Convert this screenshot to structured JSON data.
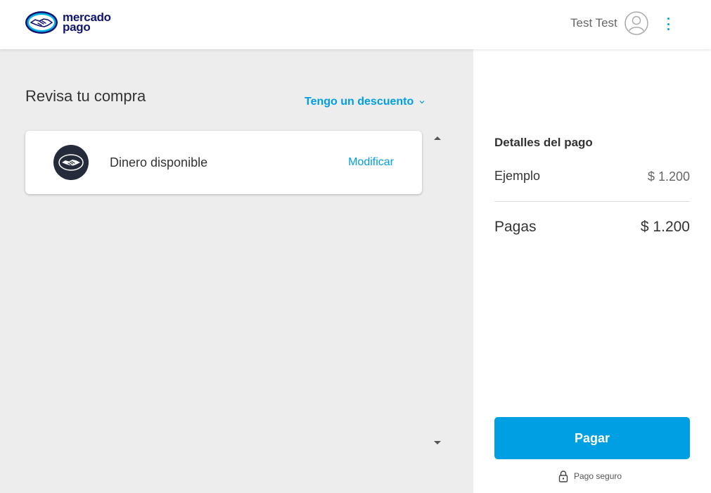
{
  "header": {
    "logo_line1": "mercado",
    "logo_line2": "pago",
    "user_name": "Test Test"
  },
  "main": {
    "title": "Revisa tu compra",
    "discount_label": "Tengo un descuento",
    "payment_method": {
      "label": "Dinero disponible",
      "action_label": "Modificar"
    }
  },
  "details": {
    "title": "Detalles del pago",
    "item_label": "Ejemplo",
    "item_value": "$ 1.200",
    "total_label": "Pagas",
    "total_value": "$ 1.200",
    "pay_button_label": "Pagar",
    "secure_label": "Pago seguro"
  },
  "colors": {
    "accent": "#009ee3",
    "brand_dark": "#10156f",
    "background": "#ededed"
  },
  "icons": {
    "logo": "handshake-icon",
    "avatar": "user-circle-icon",
    "menu": "kebab-menu-icon",
    "payment_method": "handshake-icon",
    "secure": "lock-icon"
  }
}
